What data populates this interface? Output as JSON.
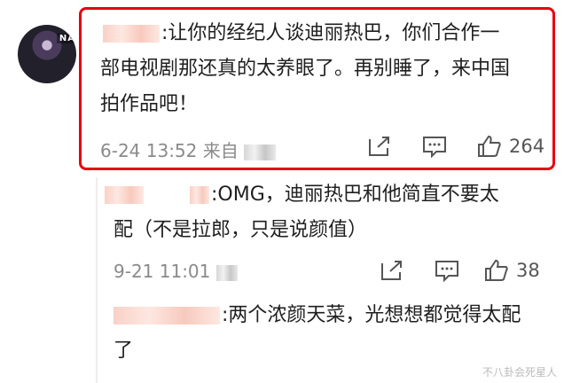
{
  "main_comment": {
    "text_line1": ":让你的经纪人谈迪丽热巴，你们合作一",
    "text_line2": "部电视剧那还真的太养眼了。再别睡了，来中国",
    "text_line3": "拍作品吧！",
    "time": "6-24 13:52",
    "source_prefix": "来自",
    "likes": "264"
  },
  "reply1": {
    "text_line1": ":OMG，迪丽热巴和他简直不要太",
    "text_line2": "配（不是拉郎，只是说颜值）",
    "time": "9-21 11:01",
    "likes": "38"
  },
  "reply2": {
    "text_line1": ":两个浓颜天菜，光想想都觉得太配",
    "text_line2": "了"
  },
  "watermark": "不八卦会死星人",
  "colors": {
    "highlight": "#e60012",
    "meta": "#8a8a8a"
  },
  "icons": [
    "share-icon",
    "comment-icon",
    "like-icon"
  ]
}
